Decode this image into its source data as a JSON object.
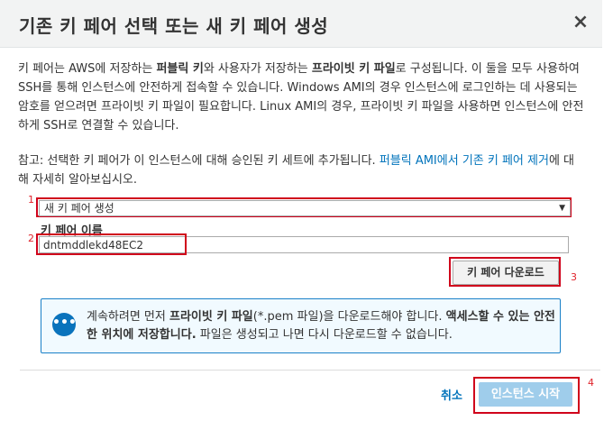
{
  "dialog": {
    "title": "기존 키 페어 선택 또는 새 키 페어 생성",
    "close_label": "×"
  },
  "description": {
    "t1": "키 페어는 AWS에 저장하는 ",
    "b1": "퍼블릭 키",
    "t2": "와 사용자가 저장하는 ",
    "b2": "프라이빗 키 파일",
    "t3": "로 구성됩니다. 이 둘을 모두 사용하여 SSH를 통해 인스턴스에 안전하게 접속할 수 있습니다. Windows AMI의 경우 인스턴스에 로그인하는 데 사용되는 암호를 얻으려면 프라이빗 키 파일이 필요합니다. Linux AMI의 경우, 프라이빗 키 파일을 사용하면 인스턴스에 안전하게 SSH로 연결할 수 있습니다."
  },
  "note": {
    "text": "참고: 선택한 키 페어가 이 인스턴스에 대해 승인된 키 세트에 추가됩니다. ",
    "link": "퍼블릭 AMI에서 기존 키 페어 제거",
    "suffix": "에 대해 자세히 알아보십시오."
  },
  "key_pair": {
    "selected_option": "새 키 페어 생성",
    "name_label": "키 페어 이름",
    "name_value": "dntmddlekd48EC2",
    "download_label": "키 페어 다운로드"
  },
  "info": {
    "icon": "chat-bubble-icon",
    "t1": "계속하려면 먼저 ",
    "b1": "프라이빗 키 파일",
    "t2": "(*.pem 파일)을 다운로드해야 합니다. ",
    "b2": "액세스할 수 있는 안전한 위치에 저장합니다.",
    "t3": " 파일은 생성되고 나면 다시 다운로드할 수 없습니다."
  },
  "footer": {
    "cancel_label": "취소",
    "launch_label": "인스턴스 시작"
  },
  "annotations": {
    "n1": "1",
    "n2": "2",
    "n3": "3",
    "n4": "4"
  },
  "colors": {
    "link": "#0073bb",
    "annotation_red": "#d0021b",
    "launch_button": "#9fcdeb",
    "info_border": "#1a80c8"
  }
}
